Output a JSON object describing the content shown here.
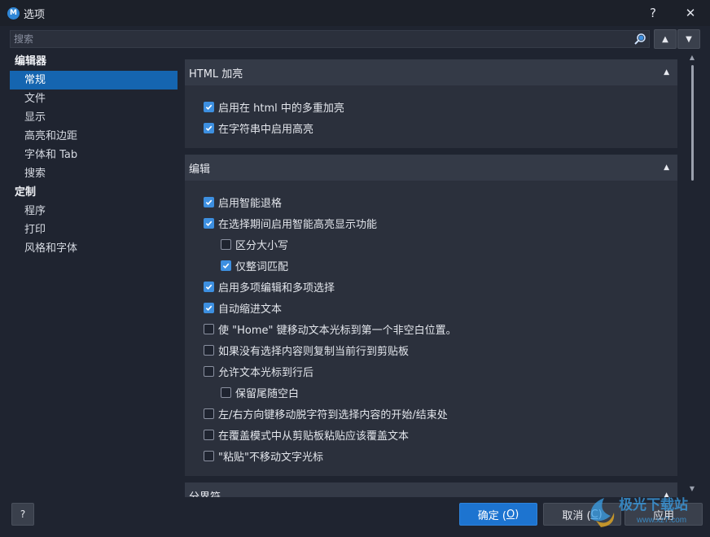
{
  "window": {
    "app_icon_letter": "M",
    "title": "选项",
    "help_glyph": "?",
    "close_glyph": "✕"
  },
  "search": {
    "placeholder": "搜索",
    "value": "",
    "up_glyph": "▲",
    "down_glyph": "▼"
  },
  "sidebar": {
    "groups": [
      {
        "label": "编辑器",
        "items": [
          {
            "label": "常规",
            "active": true
          },
          {
            "label": "文件"
          },
          {
            "label": "显示"
          },
          {
            "label": "高亮和边距"
          },
          {
            "label": "字体和 Tab"
          },
          {
            "label": "搜索"
          }
        ]
      },
      {
        "label": "定制",
        "items": [
          {
            "label": "程序"
          },
          {
            "label": "打印"
          },
          {
            "label": "风格和字体"
          }
        ]
      }
    ]
  },
  "sections": [
    {
      "title": "HTML 加亮",
      "options": [
        {
          "label": "启用在 html 中的多重加亮",
          "checked": true,
          "indent": 0
        },
        {
          "label": "在字符串中启用高亮",
          "checked": true,
          "indent": 0
        }
      ]
    },
    {
      "title": "编辑",
      "options": [
        {
          "label": "启用智能退格",
          "checked": true,
          "indent": 0
        },
        {
          "label": "在选择期间启用智能高亮显示功能",
          "checked": true,
          "indent": 0
        },
        {
          "label": "区分大小写",
          "checked": false,
          "indent": 1
        },
        {
          "label": "仅整词匹配",
          "checked": true,
          "indent": 1
        },
        {
          "label": "启用多项编辑和多项选择",
          "checked": true,
          "indent": 0
        },
        {
          "label": "自动缩进文本",
          "checked": true,
          "indent": 0
        },
        {
          "label": "使 \"Home\" 键移动文本光标到第一个非空白位置。",
          "checked": false,
          "indent": 0
        },
        {
          "label": "如果没有选择内容则复制当前行到剪贴板",
          "checked": false,
          "indent": 0
        },
        {
          "label": "允许文本光标到行后",
          "checked": false,
          "indent": 0
        },
        {
          "label": "保留尾随空白",
          "checked": false,
          "indent": 1
        },
        {
          "label": "左/右方向键移动脱字符到选择内容的开始/结束处",
          "checked": false,
          "indent": 0
        },
        {
          "label": "在覆盖模式中从剪贴板粘贴应该覆盖文本",
          "checked": false,
          "indent": 0
        },
        {
          "label": "\"粘贴\"不移动文字光标",
          "checked": false,
          "indent": 0
        }
      ]
    },
    {
      "title": "分界符",
      "options": []
    }
  ],
  "footer": {
    "help_label": "?",
    "ok_label": "确定 (",
    "ok_key": "O",
    "ok_tail": ")",
    "cancel_label": "取消 (",
    "cancel_key": "C",
    "cancel_tail": ")",
    "apply_label": "应用"
  },
  "watermark": {
    "text": "极光下载站",
    "url": "www.xz7.com"
  },
  "colors": {
    "accent": "#1565b0",
    "checkbox_on": "#3d8fe0",
    "primary_button": "#1d74d0",
    "window_bg": "#1f2430",
    "panel_bg": "#2b303c",
    "section_header_bg": "#343a47"
  }
}
